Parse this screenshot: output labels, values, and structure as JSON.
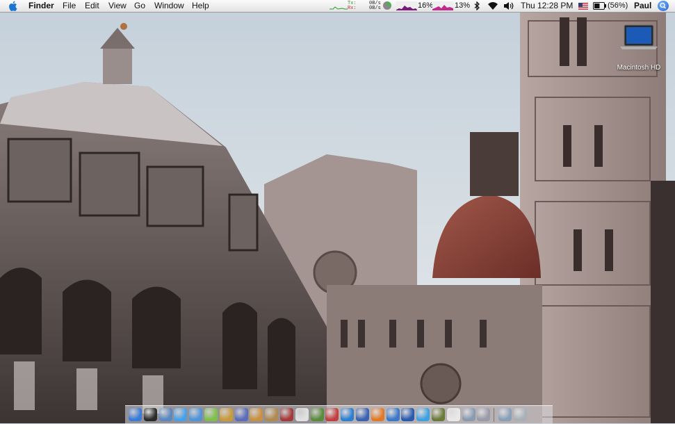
{
  "menubar": {
    "apple_icon": "apple-logo-icon",
    "app_name": "Finder",
    "menus": [
      "File",
      "Edit",
      "View",
      "Go",
      "Window",
      "Help"
    ],
    "network": {
      "tx_label": "Tx:",
      "rx_label": "Rx:",
      "tx_value": "0B/s",
      "rx_value": "0B/s"
    },
    "cpu_percent": "16%",
    "memory_percent": "13%",
    "bluetooth_icon": "bluetooth-icon",
    "wifi_icon": "wifi-icon",
    "volume_icon": "volume-icon",
    "clock": "Thu 12:28 PM",
    "flag_icon": "us-flag-icon",
    "battery_percent": "(56%)",
    "user": "Paul",
    "spotlight_icon": "spotlight-icon"
  },
  "desktop": {
    "hd_label": "Macintosh HD"
  },
  "dock": {
    "items": [
      {
        "name": "finder",
        "color": "#3b7bd8"
      },
      {
        "name": "dashboard",
        "color": "#2b2b2b"
      },
      {
        "name": "preview",
        "color": "#5a88c2"
      },
      {
        "name": "ichat",
        "color": "#4aa0e8"
      },
      {
        "name": "safari",
        "color": "#4f94d8"
      },
      {
        "name": "itunes",
        "color": "#7fbf4a"
      },
      {
        "name": "iphoto",
        "color": "#c89a3a"
      },
      {
        "name": "imovie",
        "color": "#5b6db8"
      },
      {
        "name": "garageband",
        "color": "#c89040"
      },
      {
        "name": "address-book",
        "color": "#b08a50"
      },
      {
        "name": "dictionary",
        "color": "#a43a3a"
      },
      {
        "name": "ical",
        "color": "#e0e0e0"
      },
      {
        "name": "textmate",
        "color": "#5a8c3c"
      },
      {
        "name": "flashget",
        "color": "#c04040"
      },
      {
        "name": "camino",
        "color": "#2f7fcf"
      },
      {
        "name": "word",
        "color": "#3a62b0"
      },
      {
        "name": "firefox",
        "color": "#e07a2a"
      },
      {
        "name": "ftp-client",
        "color": "#3a78c8"
      },
      {
        "name": "mac-app",
        "color": "#2a5ab0"
      },
      {
        "name": "skype",
        "color": "#3fa0e0"
      },
      {
        "name": "photoshop",
        "color": "#6a7a3a"
      },
      {
        "name": "pages",
        "color": "#e8e8e8"
      },
      {
        "name": "utilities",
        "color": "#8a9ab0"
      },
      {
        "name": "system-prefs",
        "color": "#9a9aa8"
      },
      {
        "name": "downloads",
        "color": "#8aa0b8"
      },
      {
        "name": "trash",
        "color": "#a8b0b8"
      }
    ]
  }
}
